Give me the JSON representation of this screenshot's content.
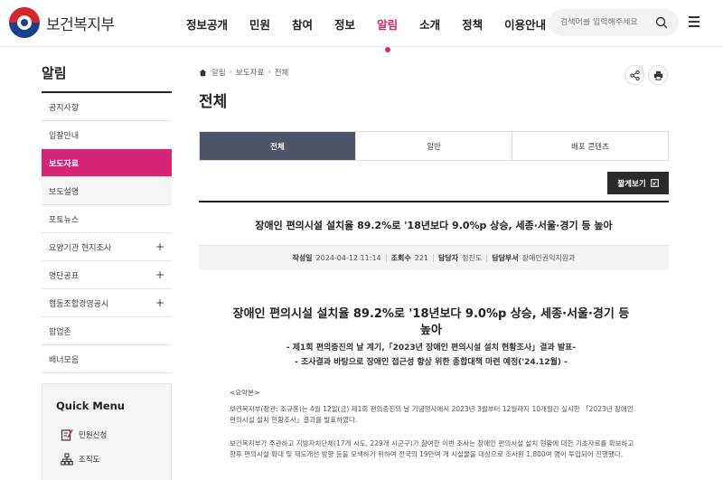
{
  "header": {
    "logo_text": "보건복지부",
    "nav": [
      "정보공개",
      "민원",
      "참여",
      "정보",
      "알림",
      "소개",
      "정책",
      "이용안내"
    ],
    "active_nav": "알림",
    "search_placeholder": "검색어를 입력해주세요"
  },
  "sidebar": {
    "title": "알림",
    "items": [
      {
        "label": "공지사항",
        "plus": ""
      },
      {
        "label": "입찰안내",
        "plus": ""
      },
      {
        "label": "보도자료",
        "plus": ""
      },
      {
        "label": "보도설명",
        "plus": ""
      },
      {
        "label": "포토뉴스",
        "plus": ""
      },
      {
        "label": "요양기관 현지조사",
        "plus": "+"
      },
      {
        "label": "명단공표",
        "plus": "+"
      },
      {
        "label": "협동조합경영공시",
        "plus": "+"
      },
      {
        "label": "팝업존",
        "plus": ""
      },
      {
        "label": "배너모음",
        "plus": ""
      }
    ]
  },
  "quick_menu": {
    "title": "Quick Menu",
    "items": [
      "민원신청",
      "조직도"
    ]
  },
  "breadcrumb": [
    "알림",
    "보도자료",
    "전체"
  ],
  "page_title": "전체",
  "tabs": [
    "전체",
    "일반",
    "배포 콘텐츠"
  ],
  "short_view_label": "짧게보기",
  "article": {
    "title": "장애인 편의시설 설치율 89.2%로 '18년보다 9.0%p 상승, 세종·서울·경기 등 높아",
    "meta": {
      "writer_label": "작성일",
      "writer_value": "2024-04-12 11:14",
      "views_label": "조회수",
      "views_value": "221",
      "manager_label": "담당자",
      "manager_value": "정진도",
      "dept_label": "담당부서",
      "dept_value": "장애인권익지원과"
    },
    "body_title": "장애인 편의시설 설치율 89.2%로 '18년보다 9.0%p 상승, 세종·서울·경기 등 높아",
    "sub1": "- 제1회 편의증진의 날 계기,「2023년 장애인 편의시설 설치 현황조사」결과 발표-",
    "sub2": "- 조사결과 바탕으로 장애인 접근성 향상 위한 종합대책 마련 예정('24.12월) -",
    "summary_label": "<요약본>",
    "para1": "보건복지부(장관: 조규홍)는 4월 12일(금) 제1회 편의증진의 날 기념행사에서 2023년 3월부터 12월까지 10개월간 실시한 「2023년 장애인 편의시설 설치 현황조사」결과를 발표하였다.",
    "para2": "보건복지부가 주관하고 지방자치단체(17개 시도, 229개 시군구)가 참여한 이번 조사는 장애인 편의시설 설치 현황에 대한 기초자료를 확보하고 향후 편의시설 확대 및 제도개선 방향 등을 모색하기 위하여 전국의 19만여 개 시설물을 대상으로 조사원 1,800여 명이 투입되어 진행됐다."
  }
}
